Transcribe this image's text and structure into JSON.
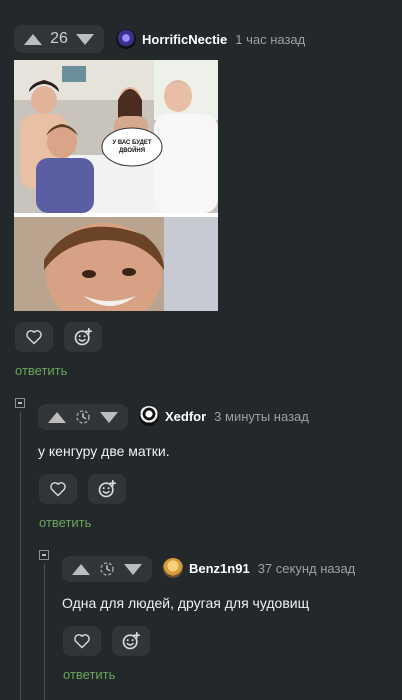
{
  "colors": {
    "background": "#23282b",
    "pill": "#2f3538",
    "reply": "#6aa45b",
    "meta": "#9aa0a4"
  },
  "comments": [
    {
      "vote_count": "26",
      "author": "HorrificNectie",
      "time": "1 час назад",
      "image": {
        "panel_top_bubble": "У ВАС БУДЕТ ДВОЙНЯ"
      },
      "reply": "ответить"
    },
    {
      "author": "Xedfor",
      "time": "3 минуты назад",
      "text": "у кенгуру две матки.",
      "reply": "ответить"
    },
    {
      "author": "Benz1n91",
      "time": "37 секунд назад",
      "text": "Одна для людей, другая для чудовищ",
      "reply": "ответить"
    }
  ],
  "icons": {
    "upvote": "triangle-up-icon",
    "downvote": "triangle-down-icon",
    "pending": "clock-icon",
    "like": "heart-icon",
    "react": "emoji-add-icon",
    "collapse": "collapse-minus-icon"
  }
}
